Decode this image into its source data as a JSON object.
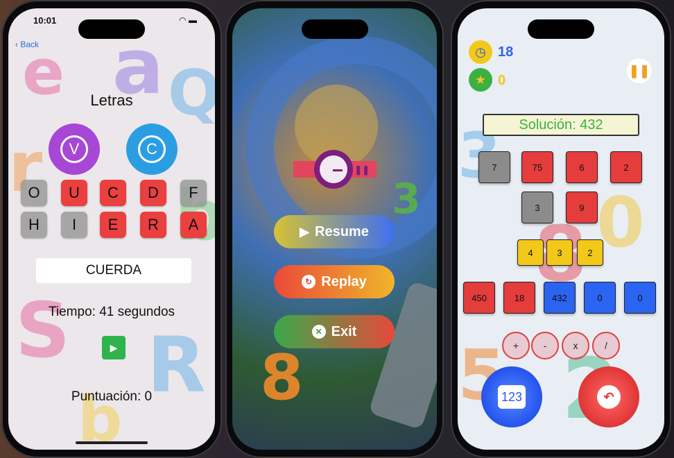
{
  "letters_screen": {
    "status_time": "10:01",
    "back_label": "Back",
    "title": "Letras",
    "vowel_button": "V",
    "consonant_button": "C",
    "tiles": [
      {
        "letter": "O",
        "color": "gray"
      },
      {
        "letter": "U",
        "color": "red"
      },
      {
        "letter": "C",
        "color": "red"
      },
      {
        "letter": "D",
        "color": "red"
      },
      {
        "letter": "F",
        "color": "gray"
      },
      {
        "letter": "H",
        "color": "gray"
      },
      {
        "letter": "I",
        "color": "gray"
      },
      {
        "letter": "E",
        "color": "red"
      },
      {
        "letter": "R",
        "color": "red"
      },
      {
        "letter": "A",
        "color": "red"
      }
    ],
    "word": "CUERDA",
    "time_text": "Tiempo: 41 segundos",
    "score_text": "Puntuación: 0"
  },
  "pause_screen": {
    "resume_label": "Resume",
    "replay_label": "Replay",
    "exit_label": "Exit"
  },
  "numbers_screen": {
    "timer_value": "18",
    "stars_value": "0",
    "solution_text": "Solución: 432",
    "numbers": [
      {
        "value": "7",
        "color": "gray"
      },
      {
        "value": "75",
        "color": "red"
      },
      {
        "value": "6",
        "color": "red"
      },
      {
        "value": "2",
        "color": "red"
      },
      {
        "value": "3",
        "color": "gray"
      },
      {
        "value": "9",
        "color": "red"
      }
    ],
    "selected": [
      "4",
      "3",
      "2"
    ],
    "results": [
      {
        "value": "450",
        "color": "red"
      },
      {
        "value": "18",
        "color": "red"
      },
      {
        "value": "432",
        "color": "blue"
      },
      {
        "value": "0",
        "color": "blue"
      },
      {
        "value": "0",
        "color": "blue"
      }
    ],
    "operators": [
      "+",
      "-",
      "x",
      "/"
    ],
    "numbers_button_label": "123"
  },
  "colors": {
    "vowel_purple": "#a747d6",
    "consonant_blue": "#2b9ee3",
    "tile_red": "#ea4040",
    "resume_gradient": [
      "#d7c235",
      "#3f6ff0"
    ],
    "replay_gradient": [
      "#ea4a3a",
      "#f0b52a"
    ],
    "exit_gradient": [
      "#3aa84a",
      "#e64a3a"
    ]
  }
}
